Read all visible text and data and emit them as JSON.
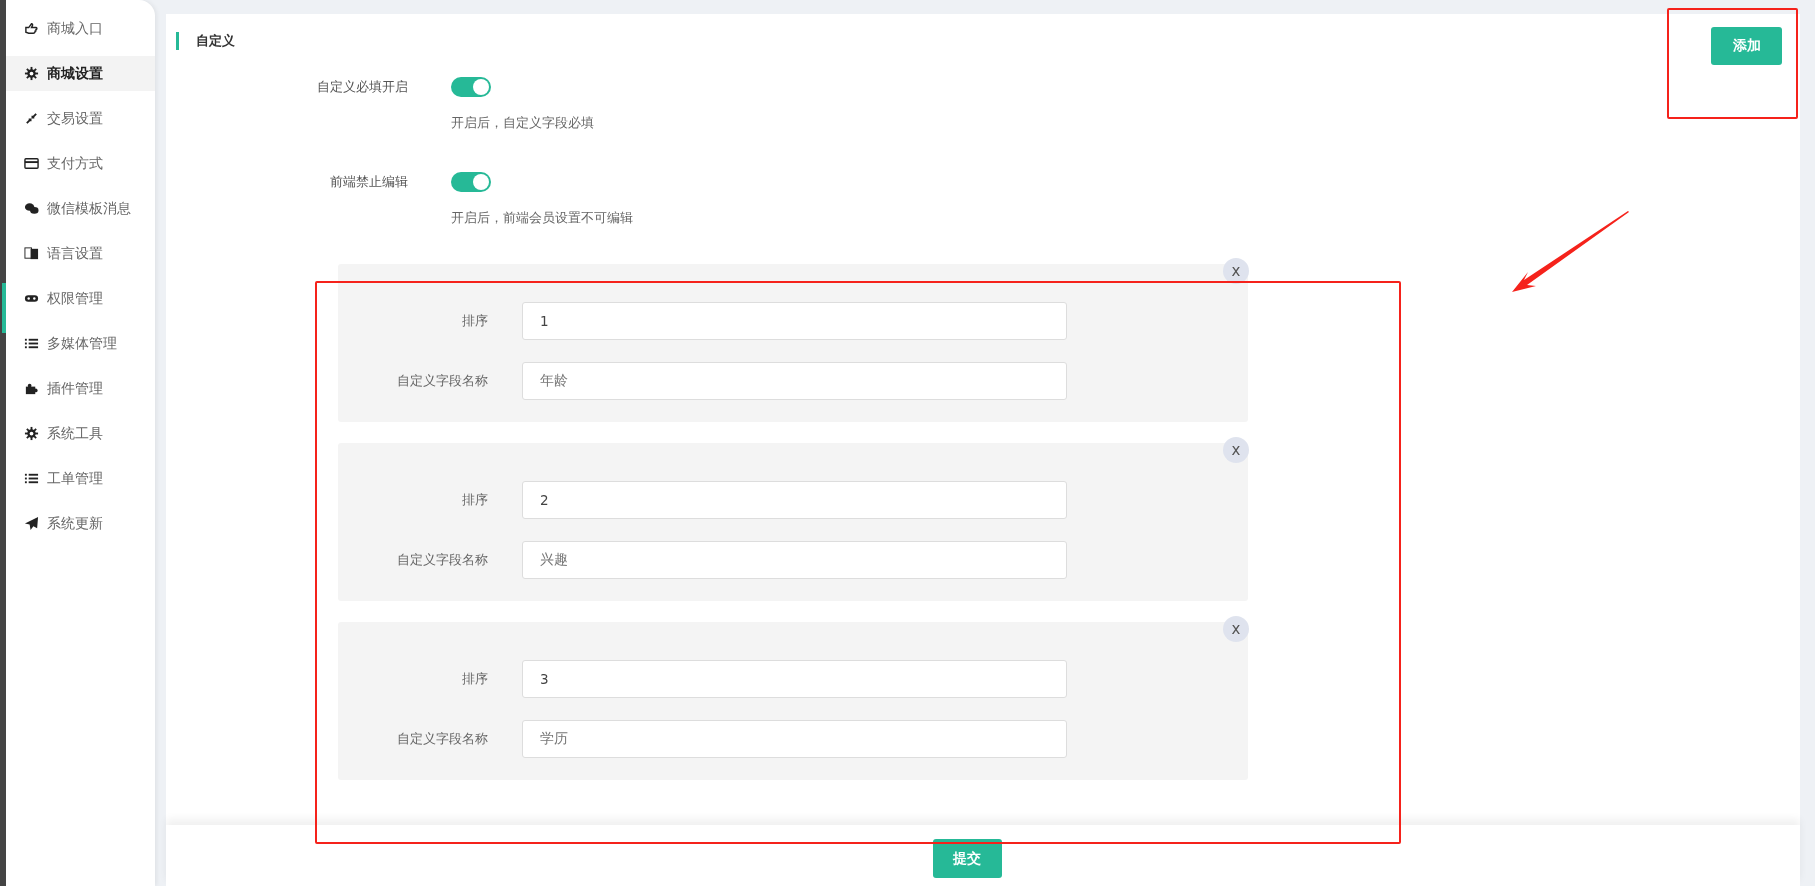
{
  "sidebar": {
    "items": [
      {
        "label": "商城入口",
        "selected": false
      },
      {
        "label": "商城设置",
        "selected": true
      },
      {
        "label": "交易设置",
        "selected": false
      },
      {
        "label": "支付方式",
        "selected": false
      },
      {
        "label": "微信模板消息",
        "selected": false
      },
      {
        "label": "语言设置",
        "selected": false
      },
      {
        "label": "权限管理",
        "selected": false
      },
      {
        "label": "多媒体管理",
        "selected": false
      },
      {
        "label": "插件管理",
        "selected": false
      },
      {
        "label": "系统工具",
        "selected": false
      },
      {
        "label": "工单管理",
        "selected": false
      },
      {
        "label": "系统更新",
        "selected": false
      }
    ]
  },
  "section_title": "自定义",
  "add_button": "添加",
  "toggles": [
    {
      "label": "自定义必填开启",
      "on": true,
      "hint": "开启后，自定义字段必填"
    },
    {
      "label": "前端禁止编辑",
      "on": true,
      "hint": "开启后，前端会员设置不可编辑"
    }
  ],
  "field_groups": [
    {
      "close": "x",
      "sort_label": "排序",
      "sort_value": "1",
      "name_label": "自定义字段名称",
      "name_value": "年龄"
    },
    {
      "close": "x",
      "sort_label": "排序",
      "sort_value": "2",
      "name_label": "自定义字段名称",
      "name_value": "兴趣"
    },
    {
      "close": "x",
      "sort_label": "排序",
      "sort_value": "3",
      "name_label": "自定义字段名称",
      "name_value": "学历"
    }
  ],
  "submit_button": "提交"
}
